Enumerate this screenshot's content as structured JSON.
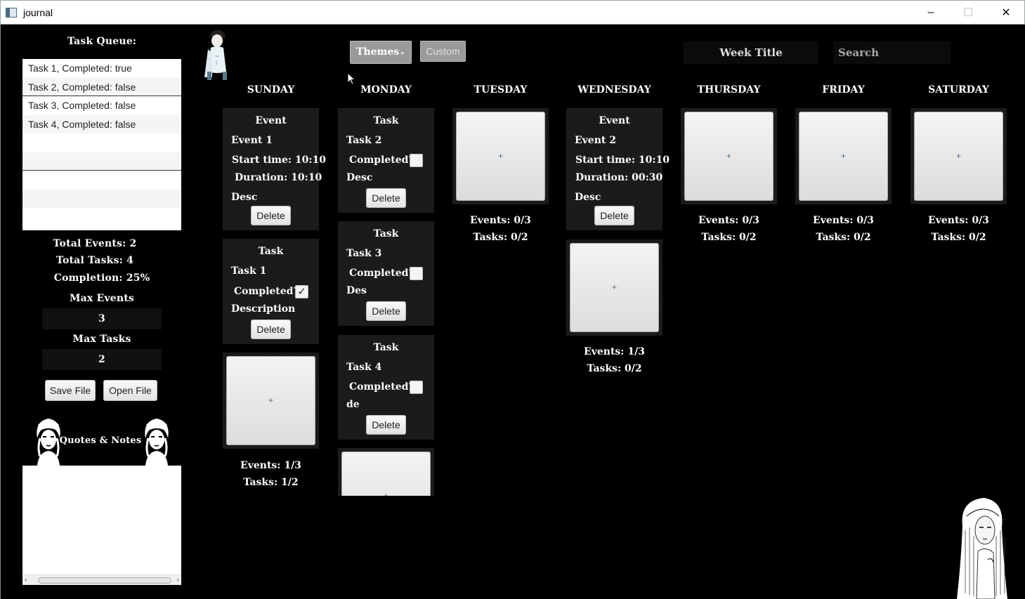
{
  "window": {
    "title": "journal",
    "minimize_glyph": "–",
    "maximize_glyph": "☐",
    "close_glyph": "✕"
  },
  "sidebar": {
    "task_queue_title": "Task Queue:",
    "task_queue": [
      "Task 1, Completed: true",
      "Task 2, Completed: false",
      "Task 3, Completed: false",
      "Task 4, Completed: false"
    ],
    "total_events": "Total Events: 2",
    "total_tasks": "Total Tasks: 4",
    "completion": "Completion: 25%",
    "max_events_label": "Max Events",
    "max_events_value": "3",
    "max_tasks_label": "Max Tasks",
    "max_tasks_value": "2",
    "save_file": "Save File",
    "open_file": "Open File",
    "quotes_title": "Quotes & Notes",
    "scroll_left": "‹",
    "scroll_right": "›"
  },
  "toolbar": {
    "themes_label": "Themes",
    "themes_chevron": "⌄",
    "custom_label": "Custom",
    "week_title": "Week Title",
    "search_placeholder": "Search"
  },
  "days": [
    "SUNDAY",
    "MONDAY",
    "TUESDAY",
    "WEDNESDAY",
    "THURSDAY",
    "FRIDAY",
    "SATURDAY"
  ],
  "cards": {
    "sun_event": {
      "type": "Event",
      "name": "Event 1",
      "start": "Start time: 10:10",
      "duration": "Duration: 10:10",
      "desc": "Desc",
      "delete": "Delete"
    },
    "sun_task": {
      "type": "Task",
      "name": "Task 1",
      "completed_label": "Completed?",
      "check": "✓",
      "desc": "Description",
      "delete": "Delete"
    },
    "mon_task2": {
      "type": "Task",
      "name": "Task 2",
      "completed_label": "Completed?",
      "desc": "Desc",
      "delete": "Delete"
    },
    "mon_task3": {
      "type": "Task",
      "name": "Task 3",
      "completed_label": "Completed?",
      "desc": "Des",
      "delete": "Delete"
    },
    "mon_task4": {
      "type": "Task",
      "name": "Task 4",
      "completed_label": "Completed?",
      "desc": "de",
      "delete": "Delete"
    },
    "wed_event": {
      "type": "Event",
      "name": "Event 2",
      "start": "Start time: 10:10",
      "duration": "Duration: 00:30",
      "desc": "Desc",
      "delete": "Delete"
    }
  },
  "add_glyph": "+",
  "counts": {
    "sun": {
      "events": "Events: 1/3",
      "tasks": "Tasks: 1/2"
    },
    "tue": {
      "events": "Events: 0/3",
      "tasks": "Tasks: 0/2"
    },
    "wed": {
      "events": "Events: 1/3",
      "tasks": "Tasks: 0/2"
    },
    "thu": {
      "events": "Events: 0/3",
      "tasks": "Tasks: 0/2"
    },
    "fri": {
      "events": "Events: 0/3",
      "tasks": "Tasks: 0/2"
    },
    "sat": {
      "events": "Events: 0/3",
      "tasks": "Tasks: 0/2"
    }
  }
}
